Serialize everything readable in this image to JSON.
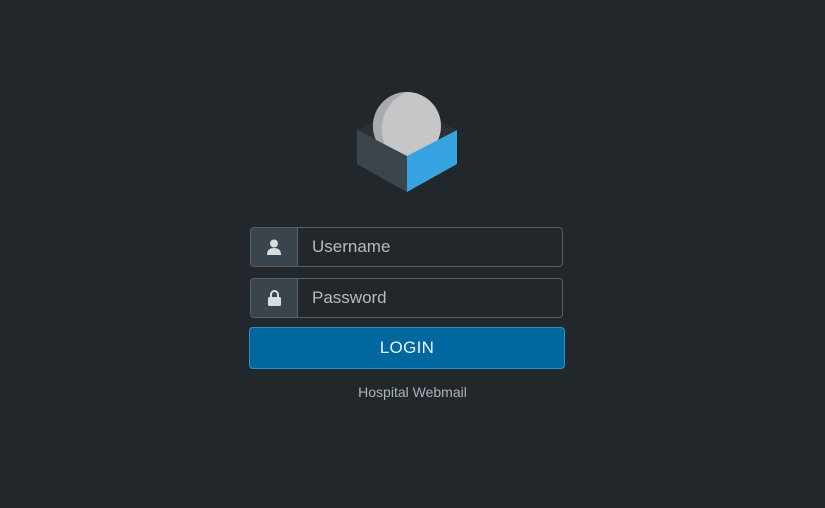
{
  "login": {
    "username_placeholder": "Username",
    "password_placeholder": "Password",
    "submit_label": "LOGIN",
    "footer_text": "Hospital Webmail"
  },
  "icons": {
    "logo": "roundcube-logo-icon",
    "username": "user-icon",
    "password": "lock-icon"
  },
  "colors": {
    "background": "#22272b",
    "accent": "#00689f",
    "logo_blue": "#37a3e0",
    "logo_gray": "#c4c6c9"
  }
}
